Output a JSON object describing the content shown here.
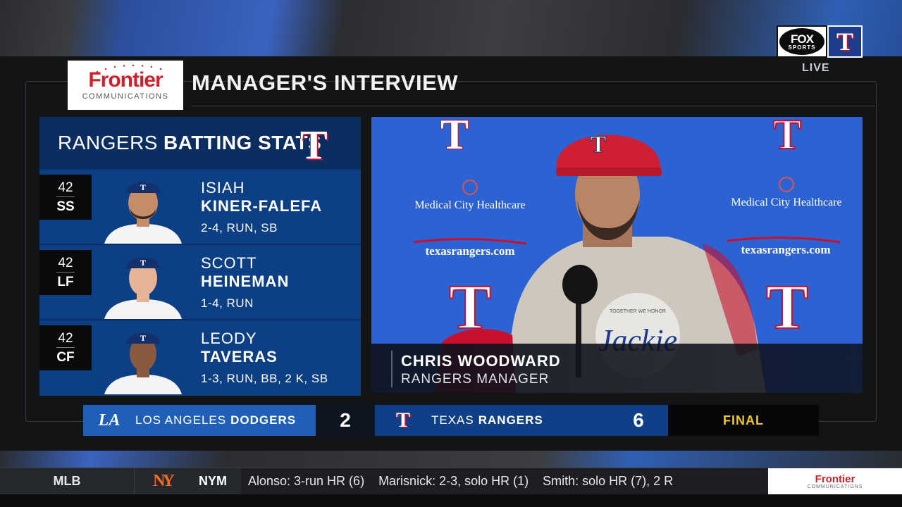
{
  "network": {
    "brand_line1": "FOX",
    "brand_line2": "SPORTS",
    "status": "LIVE",
    "team_logo_letter": "T"
  },
  "sponsor": {
    "name": "Frontier",
    "sub": "COMMUNICATIONS"
  },
  "title": "MANAGER'S INTERVIEW",
  "stats": {
    "header_light": "RANGERS",
    "header_bold": "BATTING STATS",
    "logo_letter": "T",
    "players": [
      {
        "number": "42",
        "position": "SS",
        "first": "ISIAH",
        "last": "KINER-FALEFA",
        "line": "2-4, RUN, SB",
        "skin": "#c58c68"
      },
      {
        "number": "42",
        "position": "LF",
        "first": "SCOTT",
        "last": "HEINEMAN",
        "line": "1-4, RUN",
        "skin": "#e5b497"
      },
      {
        "number": "42",
        "position": "CF",
        "first": "LEODY",
        "last": "TAVERAS",
        "line": "1-3, RUN, BB, 2 K, SB",
        "skin": "#8a5a3e"
      }
    ]
  },
  "video": {
    "backdrop_sponsor": "Medical City Healthcare",
    "backdrop_url": "texasrangers.com",
    "speaker_name": "CHRIS WOODWARD",
    "speaker_title": "RANGERS MANAGER",
    "shirt_small": "TOGETHER WE HONOR",
    "shirt_script": "Jackie"
  },
  "scoreboard": {
    "away": {
      "logo": "LA",
      "city": "LOS ANGELES",
      "nickname": "DODGERS",
      "score": "2"
    },
    "home": {
      "logo": "T",
      "city": "TEXAS",
      "nickname": "RANGERS",
      "score": "6"
    },
    "status": "FINAL"
  },
  "ticker": {
    "league": "MLB",
    "team_logo": "NY",
    "team": "NYM",
    "items": [
      "Alonso: 3-run HR (6)",
      "Marisnick: 2-3, solo HR (1)",
      "Smith: solo HR (7), 2 R"
    ],
    "sponsor_name": "Frontier",
    "sponsor_sub": "COMMUNICATIONS"
  },
  "colors": {
    "rangers_blue": "#0d3f85",
    "rangers_red": "#c8102e",
    "final_yellow": "#f5c518",
    "dodgers_blue": "#1f5fb8"
  }
}
